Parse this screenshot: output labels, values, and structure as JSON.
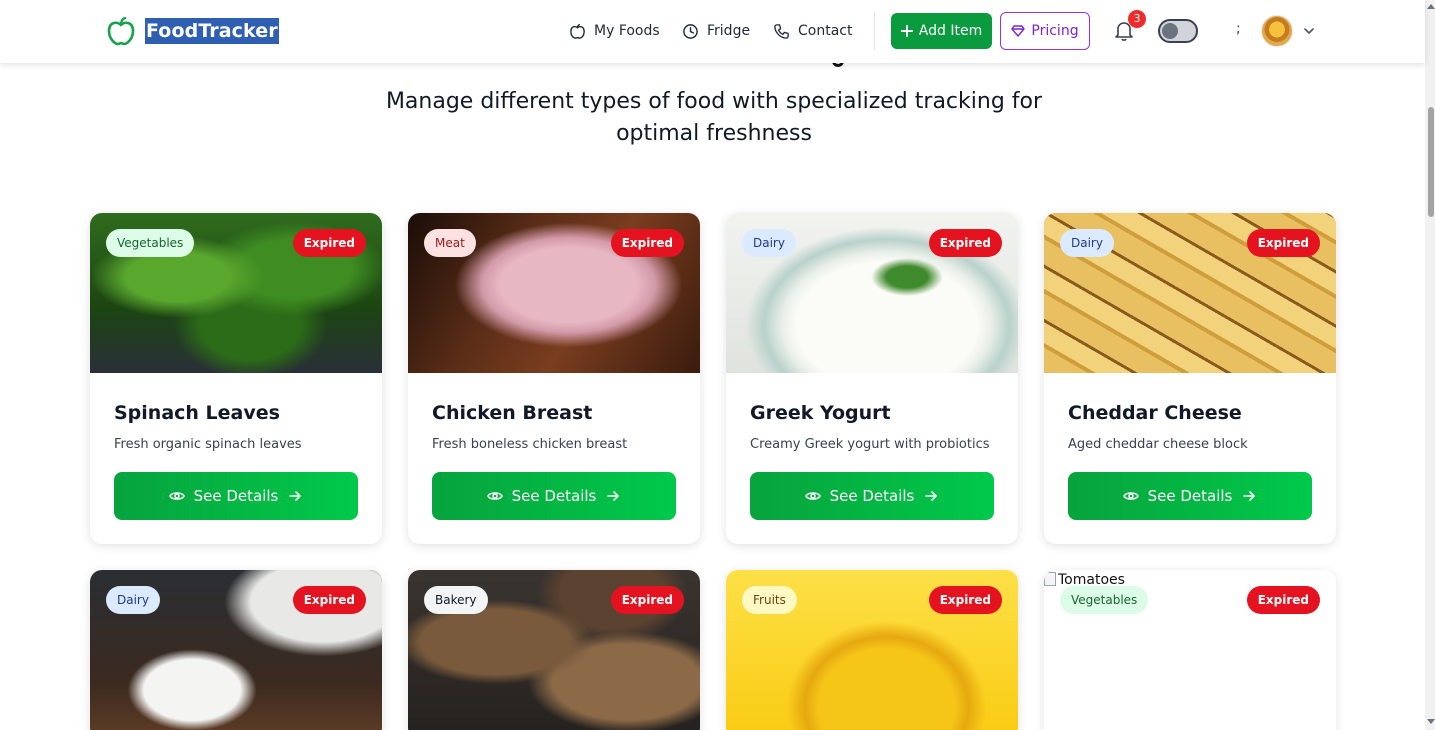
{
  "navbar": {
    "brand": "FoodTracker",
    "links": [
      {
        "label": "My Foods",
        "icon": "apple-icon"
      },
      {
        "label": "Fridge",
        "icon": "clock-icon"
      },
      {
        "label": "Contact",
        "icon": "phone-icon"
      }
    ],
    "add_item_label": "Add Item",
    "pricing_label": "Pricing",
    "notification_count": "3",
    "separator_char": ";"
  },
  "hero": {
    "subtitle": "Manage different types of food with specialized tracking for optimal freshness"
  },
  "colors": {
    "brand_green": "#0a9b3f",
    "expired_red": "#e4131f",
    "pricing_purple": "#7e22ce"
  },
  "cards": [
    {
      "category": "Vegetables",
      "status": "Expired",
      "title": "Spinach Leaves",
      "description": "Fresh organic spinach leaves",
      "button_label": "See Details"
    },
    {
      "category": "Meat",
      "status": "Expired",
      "title": "Chicken Breast",
      "description": "Fresh boneless chicken breast",
      "button_label": "See Details"
    },
    {
      "category": "Dairy",
      "status": "Expired",
      "title": "Greek Yogurt",
      "description": "Creamy Greek yogurt with probiotics",
      "button_label": "See Details"
    },
    {
      "category": "Dairy",
      "status": "Expired",
      "title": "Cheddar Cheese",
      "description": "Aged cheddar cheese block",
      "button_label": "See Details"
    },
    {
      "category": "Dairy",
      "status": "Expired"
    },
    {
      "category": "Bakery",
      "status": "Expired"
    },
    {
      "category": "Fruits",
      "status": "Expired"
    },
    {
      "category": "Vegetables",
      "status": "Expired",
      "image_alt": "Tomatoes"
    }
  ]
}
